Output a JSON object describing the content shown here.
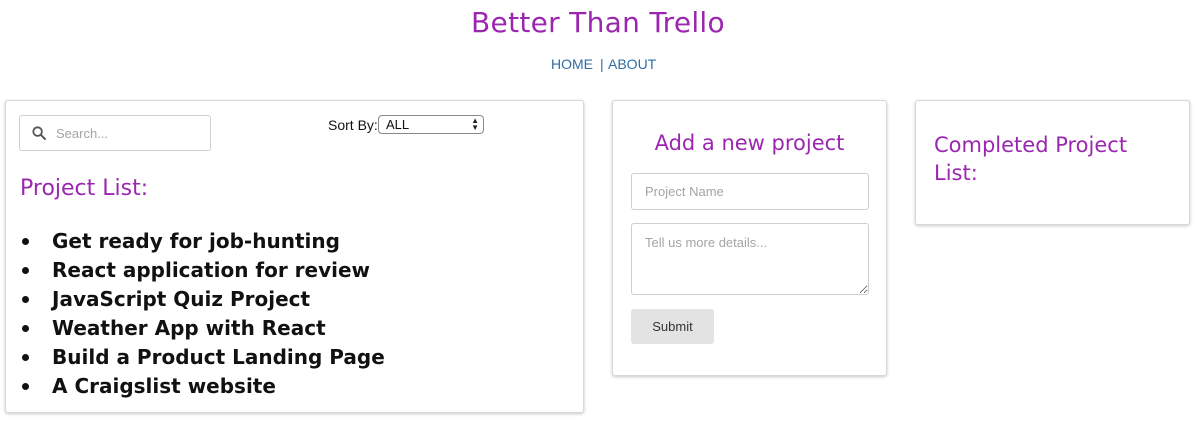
{
  "header": {
    "title": "Better Than Trello",
    "nav": {
      "home": "HOME",
      "separator": "|",
      "about": "ABOUT"
    }
  },
  "project_list_panel": {
    "search": {
      "placeholder": "Search...",
      "value": "",
      "icon": "search-icon"
    },
    "sort": {
      "label": "Sort By:",
      "selected": "ALL"
    },
    "heading": "Project List:",
    "projects": [
      "Get ready for job-hunting",
      "React application for review",
      "JavaScript Quiz Project",
      "Weather App with React",
      "Build a Product Landing Page",
      "A Craigslist website"
    ]
  },
  "add_project_panel": {
    "heading": "Add a new project",
    "name_placeholder": "Project Name",
    "details_placeholder": "Tell us more details...",
    "submit_label": "Submit"
  },
  "completed_panel": {
    "heading": "Completed Project List:"
  },
  "colors": {
    "accent": "#9b27b0",
    "link": "#2e6ea5",
    "button_bg": "#e3e3e3"
  }
}
